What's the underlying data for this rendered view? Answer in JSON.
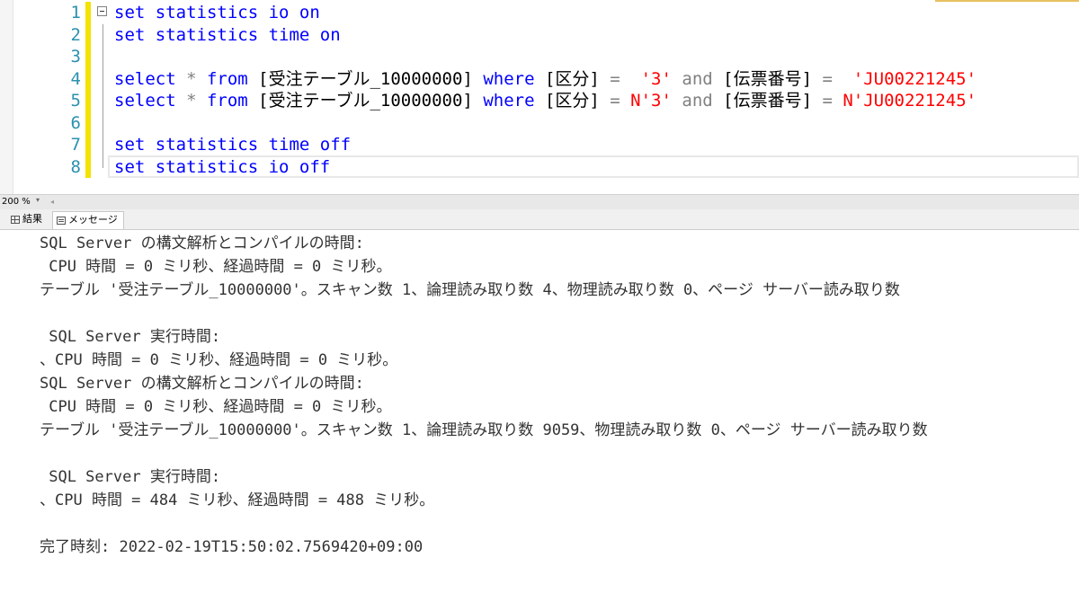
{
  "editor": {
    "lines": [
      {
        "num": "1",
        "segments": [
          [
            "kw",
            "set statistics io on"
          ]
        ]
      },
      {
        "num": "2",
        "segments": [
          [
            "kw",
            "set statistics time on"
          ]
        ]
      },
      {
        "num": "3",
        "segments": []
      },
      {
        "num": "4",
        "segments": [
          [
            "kw",
            "select "
          ],
          [
            "op",
            "* "
          ],
          [
            "kw",
            "from "
          ],
          [
            "br",
            "[受注テーブル_10000000] "
          ],
          [
            "kw",
            "where "
          ],
          [
            "br",
            "[区分] "
          ],
          [
            "op",
            "=  "
          ],
          [
            "str",
            "'3' "
          ],
          [
            "op",
            "and "
          ],
          [
            "br",
            "[伝票番号] "
          ],
          [
            "op",
            "=  "
          ],
          [
            "str",
            "'JU00221245'"
          ]
        ]
      },
      {
        "num": "5",
        "segments": [
          [
            "kw",
            "select "
          ],
          [
            "op",
            "* "
          ],
          [
            "kw",
            "from "
          ],
          [
            "br",
            "[受注テーブル_10000000] "
          ],
          [
            "kw",
            "where "
          ],
          [
            "br",
            "[区分] "
          ],
          [
            "op",
            "= "
          ],
          [
            "str",
            "N'3' "
          ],
          [
            "op",
            "and "
          ],
          [
            "br",
            "[伝票番号] "
          ],
          [
            "op",
            "= "
          ],
          [
            "str",
            "N'JU00221245'"
          ]
        ]
      },
      {
        "num": "6",
        "segments": []
      },
      {
        "num": "7",
        "segments": [
          [
            "kw",
            "set statistics time off"
          ]
        ]
      },
      {
        "num": "8",
        "segments": [
          [
            "kw",
            "set statistics io off"
          ]
        ]
      }
    ],
    "zoom": "200 %"
  },
  "tabs": {
    "results": "結果",
    "messages": "メッセージ"
  },
  "messages": [
    "SQL Server の構文解析とコンパイルの時間: ",
    " CPU 時間 = 0 ミリ秒、経過時間 = 0 ミリ秒。",
    "テーブル '受注テーブル_10000000'。スキャン数 1、論理読み取り数 4、物理読み取り数 0、ページ サーバー読み取り数",
    "",
    " SQL Server 実行時間: ",
    "、CPU 時間 = 0 ミリ秒、経過時間 = 0 ミリ秒。",
    "SQL Server の構文解析とコンパイルの時間: ",
    " CPU 時間 = 0 ミリ秒、経過時間 = 0 ミリ秒。",
    "テーブル '受注テーブル_10000000'。スキャン数 1、論理読み取り数 9059、物理読み取り数 0、ページ サーバー読み取り数",
    "",
    " SQL Server 実行時間: ",
    "、CPU 時間 = 484 ミリ秒、経過時間 = 488 ミリ秒。",
    "",
    "完了時刻: 2022-02-19T15:50:02.7569420+09:00"
  ]
}
